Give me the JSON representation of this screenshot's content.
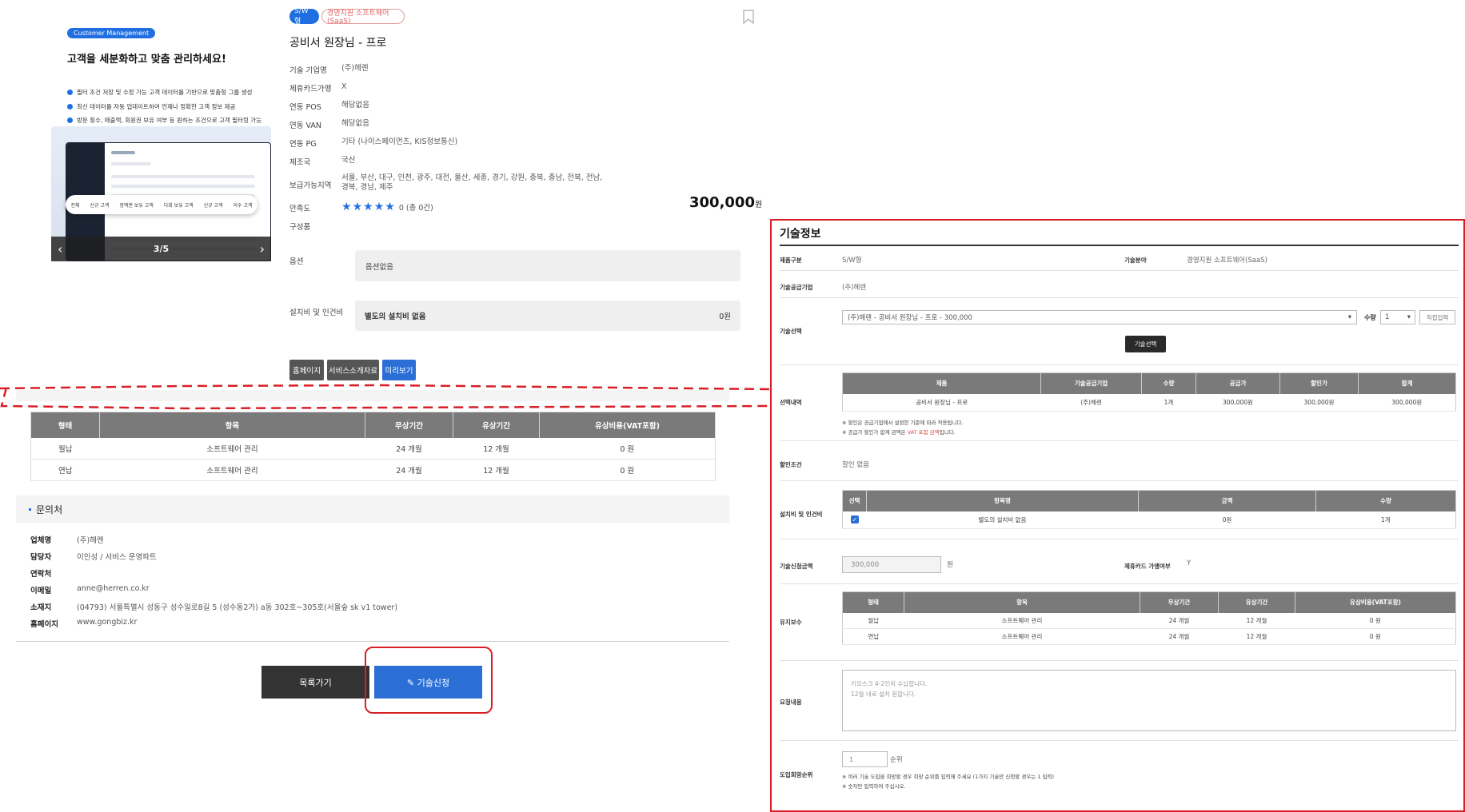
{
  "product_image": {
    "badge": "Customer Management",
    "headline": "고객을 세분화하고 맞춤 관리하세요!",
    "bullets": [
      "필터 조건 저장 및 수정 가능 고객 데이터를 기반으로 맞춤형 그룹 생성",
      "최신 데이터를 자동 업데이트하여 언제나 정확한 고객 정보 제공",
      "방문 횟수, 매출액, 회원권 보유 여부 등 원하는 조건으로 고객 필터링 가능"
    ],
    "pills": [
      "전체",
      "신규 고객",
      "정액권 보유 고객",
      "다회 보유 고객",
      "신규 고객",
      "이수 고객"
    ],
    "counter": "3/5"
  },
  "product": {
    "tag_type": "S/W형",
    "tag_category": "경영지원 소프트웨어(SaaS)",
    "title": "공비서 원장님 - 프로",
    "price": "300,000",
    "price_unit": "원",
    "info": [
      {
        "label": "기술 기업명",
        "value": "(주)헤렌"
      },
      {
        "label": "제휴카드가맹",
        "value": "X"
      },
      {
        "label": "연동 POS",
        "value": "해당없음"
      },
      {
        "label": "연동 VAN",
        "value": "해당없음"
      },
      {
        "label": "연동 PG",
        "value": "기타 (나이스페이먼츠, KIS정보통신)"
      },
      {
        "label": "제조국",
        "value": "국산"
      },
      {
        "label": "보급가능지역",
        "value": "서울, 부산, 대구, 인천, 광주, 대전, 울산, 세종, 경기, 강원, 충북, 충남, 전북, 전남, 경북, 경남, 제주"
      },
      {
        "label": "만족도",
        "value": ""
      },
      {
        "label": "구성품",
        "value": ""
      }
    ],
    "rating_stars": 5,
    "rating_text": "0 (총 0건)",
    "option_label": "옵션",
    "option_value": "옵션없음",
    "install_label": "설치비 및 인건비",
    "install_name": "별도의 설치비 없음",
    "install_price": "0원",
    "buttons": [
      "홈페이지",
      "서비스소개자료",
      "미리보기"
    ]
  },
  "maintenance_table": {
    "headers": [
      "형태",
      "항목",
      "무상기간",
      "유상기간",
      "유상비용(VAT포함)"
    ],
    "rows": [
      [
        "월납",
        "소프트웨어 관리",
        "24 개월",
        "12 개월",
        "0 원"
      ],
      [
        "연납",
        "소프트웨어 관리",
        "24 개월",
        "12 개월",
        "0 원"
      ]
    ]
  },
  "contact": {
    "heading": "문의처",
    "items": [
      {
        "label": "업체명",
        "value": "(주)헤렌"
      },
      {
        "label": "담당자",
        "value": "이인성 / 서비스 운영파트"
      },
      {
        "label": "연락처",
        "value": ""
      },
      {
        "label": "이메일",
        "value": "anne@herren.co.kr"
      },
      {
        "label": "소재지",
        "value": "(04793) 서울특별시 성동구 성수일로8길 5 (성수동2가) a동 302호~305호(서울숲 sk v1 tower)"
      },
      {
        "label": "홈페이지",
        "value": "www.gongbiz.kr"
      }
    ]
  },
  "actions": {
    "list": "목록가기",
    "apply": "✎ 기술신청"
  },
  "panel": {
    "title": "기술정보",
    "product_type_label": "제품구분",
    "product_type_value": "S/W형",
    "tech_field_label": "기술분야",
    "tech_field_value": "경영지원 소프트웨어(SaaS)",
    "supplier_label": "기술공급기업",
    "supplier_value": "(주)헤렌",
    "select_label": "기술선택",
    "select_value": "(주)헤렌 - 공비서 원장님 - 프로 - 300,000",
    "qty_label": "수량",
    "qty_value": "1",
    "direct_input": "직접입력",
    "choose_button": "기술선택",
    "selected_label": "선택내역",
    "selected_table": {
      "headers": [
        "제품",
        "기술공급기업",
        "수량",
        "공급가",
        "할인가",
        "합계"
      ],
      "rows": [
        [
          "공비서 원장님 - 프로",
          "(주)헤렌",
          "1개",
          "300,000원",
          "300,000원",
          "300,000원"
        ]
      ]
    },
    "notes": [
      "※ 할인은 공급기업에서 설정한 기준에 따라 적용됩니다.",
      "※ 공급가 할인가 합계 금액은",
      "VAT 포함 금액",
      "입니다."
    ],
    "discount_label": "할인조건",
    "discount_value": "할인 없음",
    "install_label": "설치비 및 인건비",
    "install_table": {
      "headers": [
        "선택",
        "항목명",
        "금액",
        "수량"
      ],
      "rows": [
        [
          "",
          "별도의 설치비 없음",
          "0원",
          "1개"
        ]
      ]
    },
    "request_amount_label": "기술신청금액",
    "request_amount_value": "300,000",
    "request_amount_unit": "원",
    "card_label": "제휴카드 가맹여부",
    "card_value": "Y",
    "maintenance_label": "유지보수",
    "maintenance_table": {
      "headers": [
        "형태",
        "항목",
        "무상기간",
        "유상기간",
        "유상비용(VAT포함)"
      ],
      "rows": [
        [
          "월납",
          "소프트웨어 관리",
          "24 개월",
          "12 개월",
          "0 원"
        ],
        [
          "연납",
          "소프트웨어 관리",
          "24 개월",
          "12 개월",
          "0 원"
        ]
      ]
    },
    "request_label": "요청내용",
    "request_text_1": "키오스크 4-2인치 수납합니다.",
    "request_text_2": "12월 내로 설치 원합니다.",
    "priority_label": "도입희망순위",
    "priority_value": "1",
    "priority_unit": "순위",
    "priority_note_1": "※ 여러 기술 도입을 희망할 경우 희망 순위를 입력해 주세요 (1가지 기술만 신청할 경우는 1 입력)",
    "priority_note_2": "※ 숫자만 입력하여 주십시오."
  },
  "colors": {
    "accent": "#2b6fd6",
    "highlight": "#d81f26",
    "header_gray": "#7a7a7a"
  }
}
